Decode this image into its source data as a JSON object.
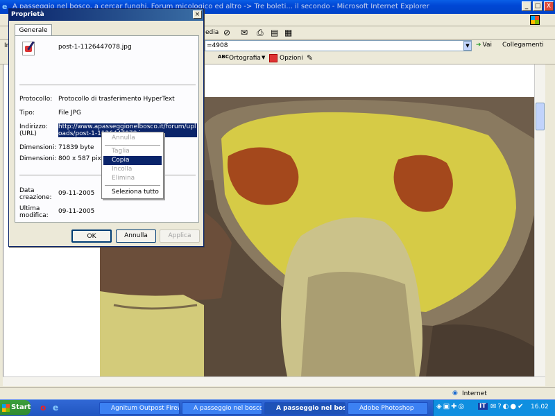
{
  "window": {
    "title": "A passeggio nel bosco, a cercar funghi. Forum micologico ed altro -> Tre boleti... il secondo - Microsoft Internet Explorer",
    "minimize": "_",
    "maximize": "□",
    "close": "X"
  },
  "toolbar": {
    "media_label": "edia"
  },
  "address": {
    "label": "In",
    "value": "=4908",
    "go_label": "Vai",
    "links_label": "Collegamenti"
  },
  "links": {
    "spelling_label": "Ortografia",
    "options_label": "Opzioni"
  },
  "dialog": {
    "title": "Proprietà",
    "close": "×",
    "tab": "Generale",
    "filename": "post-1-1126447078.jpg",
    "rows": [
      {
        "label": "Protocollo:",
        "value": "Protocollo di trasferimento HyperText"
      },
      {
        "label": "Tipo:",
        "value": "File JPG"
      },
      {
        "label": "Indirizzo: (URL)",
        "value": "http://www.apasseggionelbosco.it/forum/uploads/post-1-1126447078.jpg"
      },
      {
        "label": "Dimensioni:",
        "value": "71839 byte"
      },
      {
        "label": "Dimensioni:",
        "value": "800 x 587 pixel"
      },
      {
        "label": "Data creazione:",
        "value": "09-11-2005"
      },
      {
        "label": "Ultima modifica:",
        "value": "09-11-2005"
      }
    ],
    "ok": "OK",
    "cancel": "Annulla",
    "apply": "Applica"
  },
  "context_menu": {
    "items": [
      "Annulla",
      "Taglia",
      "Copia",
      "Incolla",
      "Elimina",
      "Seleziona tutto"
    ]
  },
  "status": {
    "zone": "Internet"
  },
  "taskbar": {
    "start": "Start",
    "tasks": [
      "Agnitum Outpost Firew...",
      "A passeggio nel bosco, ...",
      "A passeggio nel bosc...",
      "Adobe Photoshop"
    ],
    "clock": "16.02",
    "lang": "IT"
  },
  "colors": {
    "xp_blue": "#0046d5",
    "selection": "#0a246a",
    "mushroom_cap": "#d9cf4a"
  }
}
